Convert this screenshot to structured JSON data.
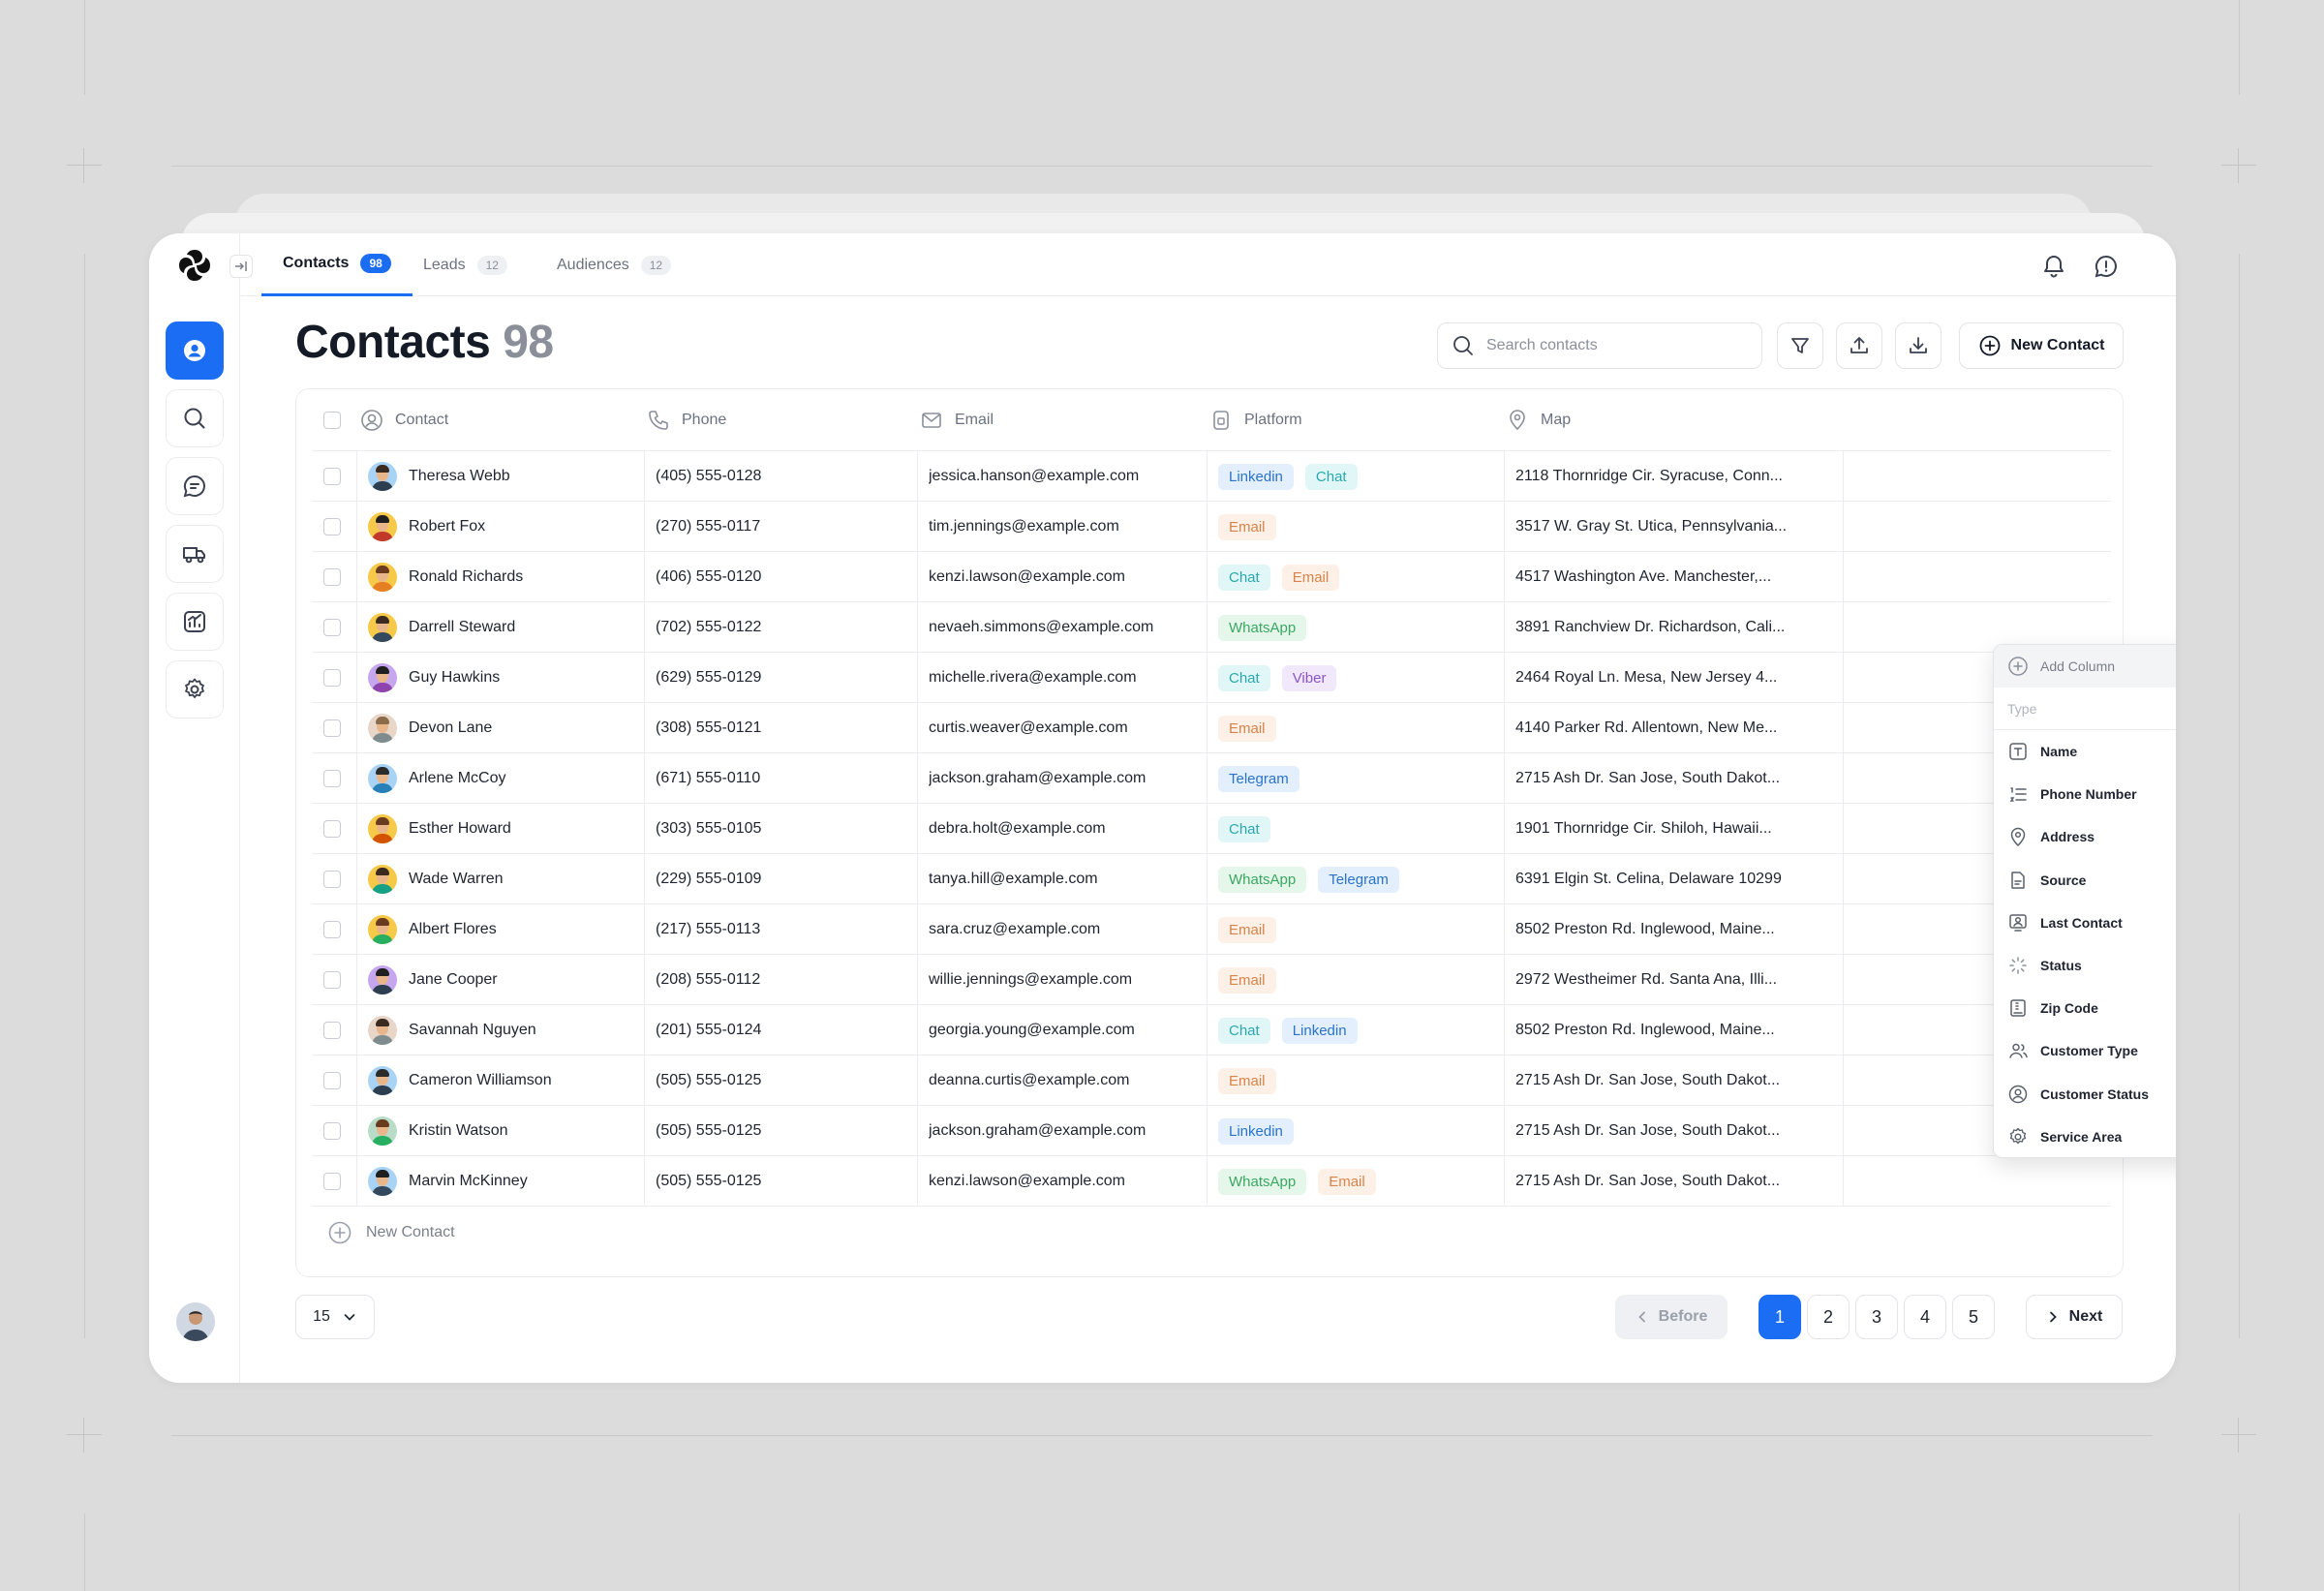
{
  "tabs": [
    {
      "label": "Contacts",
      "count": "98"
    },
    {
      "label": "Leads",
      "count": "12"
    },
    {
      "label": "Audiences",
      "count": "12"
    }
  ],
  "page": {
    "title": "Contacts",
    "count": "98"
  },
  "search": {
    "placeholder": "Search contacts"
  },
  "toolbar": {
    "new_contact_label": "New Contact"
  },
  "columns": [
    "Contact",
    "Phone",
    "Email",
    "Platform",
    "Map"
  ],
  "rows": [
    {
      "name": "Theresa Webb",
      "phone": "(405) 555-0128",
      "email": "jessica.hanson@example.com",
      "platforms": [
        "Linkedin",
        "Chat"
      ],
      "map": "2118 Thornridge Cir. Syracuse, Conn..."
    },
    {
      "name": "Robert Fox",
      "phone": "(270) 555-0117",
      "email": "tim.jennings@example.com",
      "platforms": [
        "Email"
      ],
      "map": "3517 W. Gray St. Utica, Pennsylvania..."
    },
    {
      "name": "Ronald Richards",
      "phone": "(406) 555-0120",
      "email": "kenzi.lawson@example.com",
      "platforms": [
        "Chat",
        "Email"
      ],
      "map": "4517 Washington Ave. Manchester,..."
    },
    {
      "name": "Darrell Steward",
      "phone": "(702) 555-0122",
      "email": "nevaeh.simmons@example.com",
      "platforms": [
        "WhatsApp"
      ],
      "map": "3891 Ranchview Dr. Richardson, Cali..."
    },
    {
      "name": "Guy Hawkins",
      "phone": "(629) 555-0129",
      "email": "michelle.rivera@example.com",
      "platforms": [
        "Chat",
        "Viber"
      ],
      "map": "2464 Royal Ln. Mesa, New Jersey 4..."
    },
    {
      "name": "Devon Lane",
      "phone": "(308) 555-0121",
      "email": "curtis.weaver@example.com",
      "platforms": [
        "Email"
      ],
      "map": "4140 Parker Rd. Allentown, New Me..."
    },
    {
      "name": "Arlene McCoy",
      "phone": "(671) 555-0110",
      "email": "jackson.graham@example.com",
      "platforms": [
        "Telegram"
      ],
      "map": "2715 Ash Dr. San Jose, South Dakot..."
    },
    {
      "name": "Esther Howard",
      "phone": "(303) 555-0105",
      "email": "debra.holt@example.com",
      "platforms": [
        "Chat"
      ],
      "map": "1901 Thornridge Cir. Shiloh, Hawaii..."
    },
    {
      "name": "Wade Warren",
      "phone": "(229) 555-0109",
      "email": "tanya.hill@example.com",
      "platforms": [
        "WhatsApp",
        "Telegram"
      ],
      "map": "6391 Elgin St. Celina, Delaware 10299"
    },
    {
      "name": "Albert Flores",
      "phone": "(217) 555-0113",
      "email": "sara.cruz@example.com",
      "platforms": [
        "Email"
      ],
      "map": "8502 Preston Rd. Inglewood, Maine..."
    },
    {
      "name": "Jane Cooper",
      "phone": "(208) 555-0112",
      "email": "willie.jennings@example.com",
      "platforms": [
        "Email"
      ],
      "map": "2972 Westheimer Rd. Santa Ana, Illi..."
    },
    {
      "name": "Savannah Nguyen",
      "phone": "(201) 555-0124",
      "email": "georgia.young@example.com",
      "platforms": [
        "Chat",
        "Linkedin"
      ],
      "map": "8502 Preston Rd. Inglewood, Maine..."
    },
    {
      "name": "Cameron Williamson",
      "phone": "(505) 555-0125",
      "email": "deanna.curtis@example.com",
      "platforms": [
        "Email"
      ],
      "map": "2715 Ash Dr. San Jose, South Dakot..."
    },
    {
      "name": "Kristin Watson",
      "phone": "(505) 555-0125",
      "email": "jackson.graham@example.com",
      "platforms": [
        "Linkedin"
      ],
      "map": "2715 Ash Dr. San Jose, South Dakot..."
    },
    {
      "name": "Marvin McKinney",
      "phone": "(505) 555-0125",
      "email": "kenzi.lawson@example.com",
      "platforms": [
        "WhatsApp",
        "Email"
      ],
      "map": "2715 Ash Dr. San Jose, South Dakot..."
    }
  ],
  "add_row_label": "New Contact",
  "dropdown": {
    "header": "Add Column",
    "type_placeholder": "Type",
    "items": [
      {
        "label": "Name",
        "icon": "text-t-icon"
      },
      {
        "label": "Phone Number",
        "icon": "numbered-list-icon"
      },
      {
        "label": "Address",
        "icon": "map-pin-icon"
      },
      {
        "label": "Source",
        "icon": "file-icon"
      },
      {
        "label": "Last Contact",
        "icon": "user-screen-icon"
      },
      {
        "label": "Status",
        "icon": "spinner-icon"
      },
      {
        "label": "Zip Code",
        "icon": "zip-file-icon"
      },
      {
        "label": "Customer Type",
        "icon": "users-icon"
      },
      {
        "label": "Customer Status",
        "icon": "user-circle-icon"
      },
      {
        "label": "Service Area",
        "icon": "gear-icon"
      }
    ]
  },
  "pagination": {
    "per_page": "15",
    "before_label": "Before",
    "next_label": "Next",
    "pages": [
      "1",
      "2",
      "3",
      "4",
      "5"
    ],
    "current": "1"
  },
  "colors": {
    "accent": "#1b6ef3",
    "Linkedin": "p-linkedin",
    "Chat": "p-chat",
    "Email": "p-email",
    "WhatsApp": "p-whatsapp",
    "Viber": "p-viber",
    "Telegram": "p-telegram"
  }
}
